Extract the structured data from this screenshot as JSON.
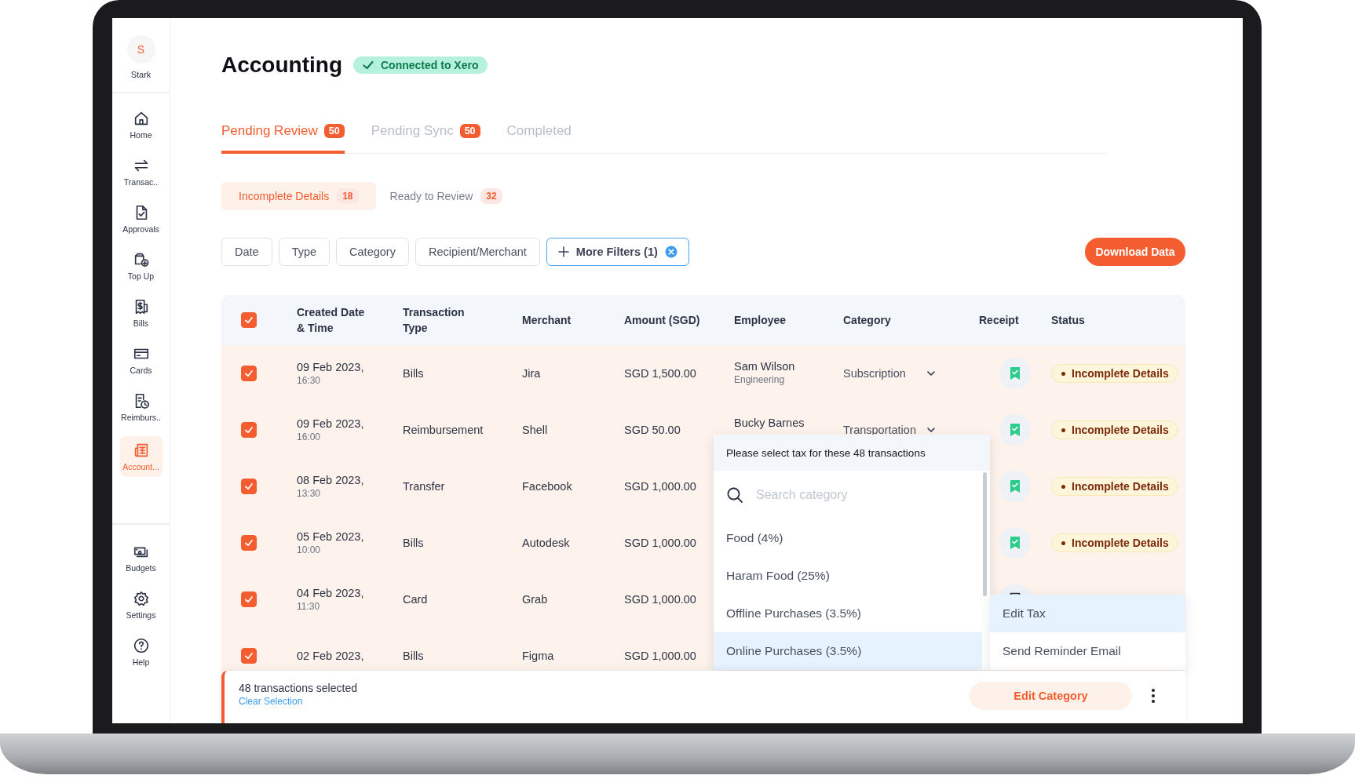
{
  "sidebar": {
    "avatar": {
      "initial": "S",
      "name": "Stark"
    },
    "items": [
      {
        "label": "Home",
        "kind": "home",
        "selected": false
      },
      {
        "label": "Transac..",
        "kind": "transfer",
        "selected": false
      },
      {
        "label": "Approvals",
        "kind": "approval",
        "selected": false
      },
      {
        "label": "Top Up",
        "kind": "topup",
        "selected": false
      },
      {
        "label": "Bills",
        "kind": "bill",
        "selected": false
      },
      {
        "label": "Cards",
        "kind": "card",
        "selected": false
      },
      {
        "label": "Reimburs..",
        "kind": "reimburse",
        "selected": false
      },
      {
        "label": "Account...",
        "kind": "ledger",
        "selected": true
      }
    ],
    "bottom_items": [
      {
        "label": "Budgets",
        "kind": "budget",
        "selected": false
      },
      {
        "label": "Settings",
        "kind": "settings",
        "selected": false
      },
      {
        "label": "Help",
        "kind": "help",
        "selected": false
      }
    ]
  },
  "header": {
    "title": "Accounting",
    "connection_badge": "Connected to Xero"
  },
  "tabs": [
    {
      "label": "Pending Review",
      "count": "50",
      "selected": true
    },
    {
      "label": "Pending Sync",
      "count": "50",
      "selected": false
    },
    {
      "label": "Completed",
      "selected": false
    }
  ],
  "subtabs": [
    {
      "label": "Incomplete Details",
      "count": "18",
      "selected": true
    },
    {
      "label": "Ready to Review",
      "count": "32",
      "selected": false
    }
  ],
  "filters": [
    {
      "label": "Date",
      "kind": "plain"
    },
    {
      "label": "Type",
      "kind": "plain"
    },
    {
      "label": "Category",
      "kind": "plain"
    },
    {
      "label": "Recipient/Merchant",
      "kind": "plain"
    },
    {
      "label": "More Filters (1)",
      "kind": "more"
    }
  ],
  "download_button": "Download Data",
  "table": {
    "header_checked": true,
    "columns": [
      "Created Date & Time",
      "Transaction Type",
      "Merchant",
      "Amount (SGD)",
      "Employee",
      "Category",
      "Receipt",
      "Status"
    ],
    "rows": [
      {
        "checked": true,
        "date": "09 Feb 2023,",
        "time": "16:30",
        "type": "Bills",
        "merchant": "Jira",
        "amount": "SGD 1,500.00",
        "employee": "Sam Wilson",
        "department": "Engineering",
        "category": "Subscription",
        "receipt_attached": true,
        "status": "Incomplete Details"
      },
      {
        "checked": true,
        "date": "09 Feb 2023,",
        "time": "16:00",
        "type": "Reimbursement",
        "merchant": "Shell",
        "amount": "SGD 50.00",
        "employee": "Bucky Barnes",
        "category": "Transportation",
        "receipt_attached": true,
        "status": "Incomplete Details"
      },
      {
        "checked": true,
        "date": "08 Feb 2023,",
        "time": "13:30",
        "type": "Transfer",
        "merchant": "Facebook",
        "amount": "SGD 1,000.00",
        "receipt_attached": true,
        "status": "Incomplete Details"
      },
      {
        "checked": true,
        "date": "05 Feb 2023,",
        "time": "10:00",
        "type": "Bills",
        "merchant": "Autodesk",
        "amount": "SGD 1,000.00",
        "receipt_attached": true,
        "status": "Incomplete Details"
      },
      {
        "checked": true,
        "date": "04 Feb 2023,",
        "time": "11:30",
        "type": "Card",
        "merchant": "Grab",
        "amount": "SGD 1,000.00",
        "receipt_attached": false
      },
      {
        "checked": true,
        "date": "02 Feb 2023,",
        "type": "Bills",
        "merchant": "Figma",
        "amount": "SGD 1,000.00"
      }
    ]
  },
  "tax_dropdown": {
    "title": "Please select tax for these 48 transactions",
    "search_placeholder": "Search category",
    "options": [
      {
        "label": "Food (4%)",
        "selected": false
      },
      {
        "label": "Haram Food (25%)",
        "selected": false
      },
      {
        "label": "Offline Purchases (3.5%)",
        "selected": false
      },
      {
        "label": "Online Purchases (3.5%)",
        "selected": true
      }
    ]
  },
  "action_menu": [
    {
      "label": "Edit Tax",
      "selected": true
    },
    {
      "label": "Send Reminder Email",
      "selected": false
    }
  ],
  "selection_bar": {
    "summary": "48 transactions selected",
    "clear_link": "Clear Selection",
    "action_button": "Edit Category"
  }
}
